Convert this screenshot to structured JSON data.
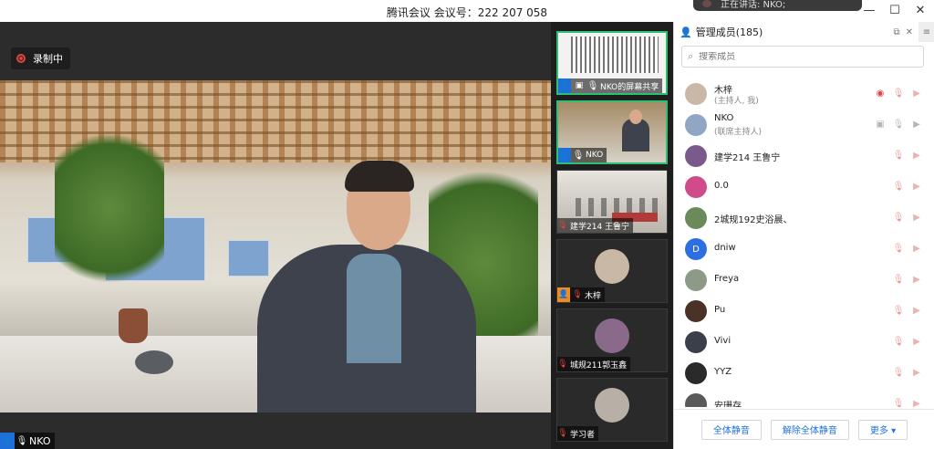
{
  "window": {
    "title": "腾讯会议 会议号：222 207 058",
    "notify_text": "正在讲话: NKO;",
    "controls": {
      "minimize": "—",
      "maximize": "☐",
      "close": "✕"
    }
  },
  "main_video": {
    "recording_label": "录制中",
    "speaker_name": "NKO"
  },
  "thumbnails": [
    {
      "label": "NKO的屏幕共享",
      "kind": "share",
      "active": true
    },
    {
      "label": "NKO",
      "kind": "host",
      "active": true
    },
    {
      "label": "建学214 王鲁宁",
      "kind": "muted",
      "active": false
    },
    {
      "label": "木梓",
      "kind": "host-orange",
      "active": false
    },
    {
      "label": "城规211郭玉鑫",
      "kind": "muted",
      "active": false
    },
    {
      "label": "学习者",
      "kind": "muted",
      "active": false
    }
  ],
  "panel": {
    "title": "管理成员(185)",
    "search_placeholder": "搜索成员",
    "members": [
      {
        "name": "木梓",
        "role": "(主持人, 我)",
        "avatar_color": "#c9b8a5",
        "recording": true
      },
      {
        "name": "NKO",
        "role": "(联席主持人)",
        "avatar_color": "#8fa6c4",
        "recording": false
      },
      {
        "name": "建学214 王鲁宁",
        "role": "",
        "avatar_color": "#7a5a8a",
        "recording": false
      },
      {
        "name": "0.0",
        "role": "",
        "avatar_color": "#d04b8a",
        "recording": false
      },
      {
        "name": "2城规192史浴晨、",
        "role": "",
        "avatar_color": "#6a8a5a",
        "recording": false
      },
      {
        "name": "dniw",
        "role": "",
        "avatar_color": "#2d6fe0",
        "avatar_letter": "D",
        "recording": false
      },
      {
        "name": "Freya",
        "role": "",
        "avatar_color": "#8d9a88",
        "recording": false
      },
      {
        "name": "Pu",
        "role": "",
        "avatar_color": "#4a3228",
        "recording": false
      },
      {
        "name": "Vivi",
        "role": "",
        "avatar_color": "#3a3f4a",
        "recording": false
      },
      {
        "name": "YYZ",
        "role": "",
        "avatar_color": "#2a2a2a",
        "recording": false
      },
      {
        "name": "安珊存",
        "role": "",
        "avatar_color": "#5a5a5a",
        "recording": false
      }
    ],
    "footer": {
      "mute_all": "全体静音",
      "unmute_all": "解除全体静音",
      "more": "更多 ▾"
    }
  }
}
